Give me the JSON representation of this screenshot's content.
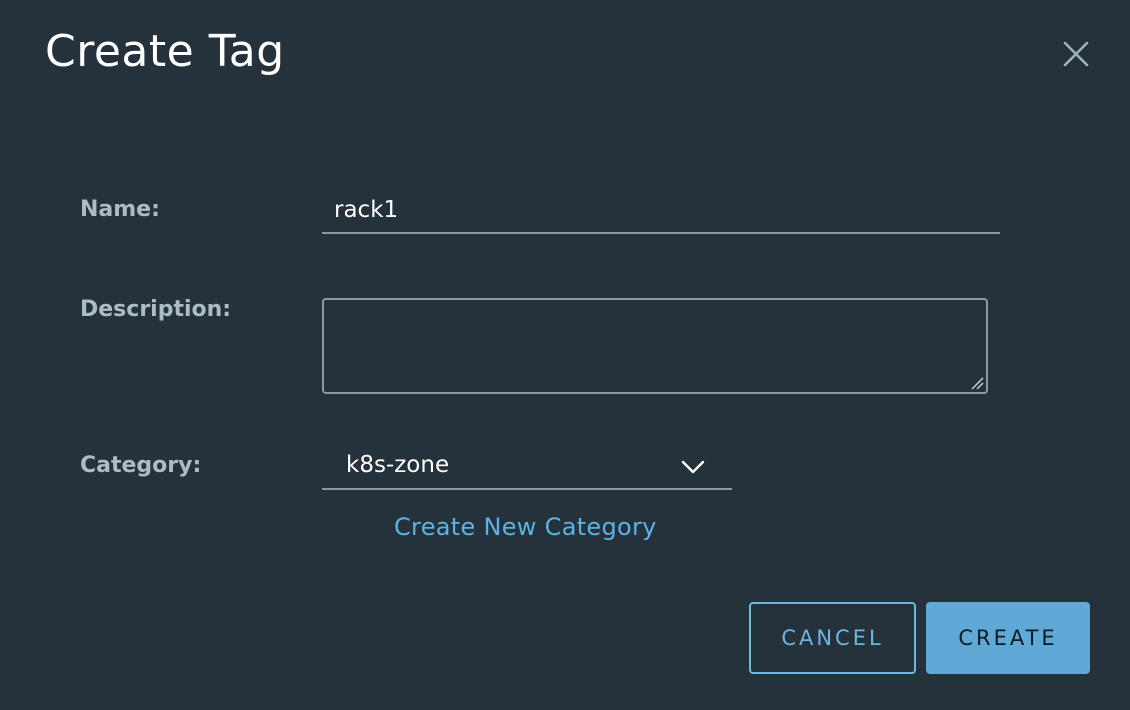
{
  "dialog": {
    "title": "Create Tag"
  },
  "form": {
    "name_label": "Name:",
    "name_value": "rack1",
    "description_label": "Description:",
    "description_value": "",
    "category_label": "Category:",
    "category_selected": "k8s-zone",
    "create_category_link": "Create New Category"
  },
  "footer": {
    "cancel_label": "CANCEL",
    "create_label": "CREATE"
  },
  "icons": {
    "close": "close-icon",
    "dropdown": "chevron-down-icon",
    "resize": "resize-grip-icon"
  },
  "colors": {
    "background": "#25323b",
    "accent": "#5fa9d6",
    "link": "#5bb2e6",
    "label": "#adbbc4"
  }
}
